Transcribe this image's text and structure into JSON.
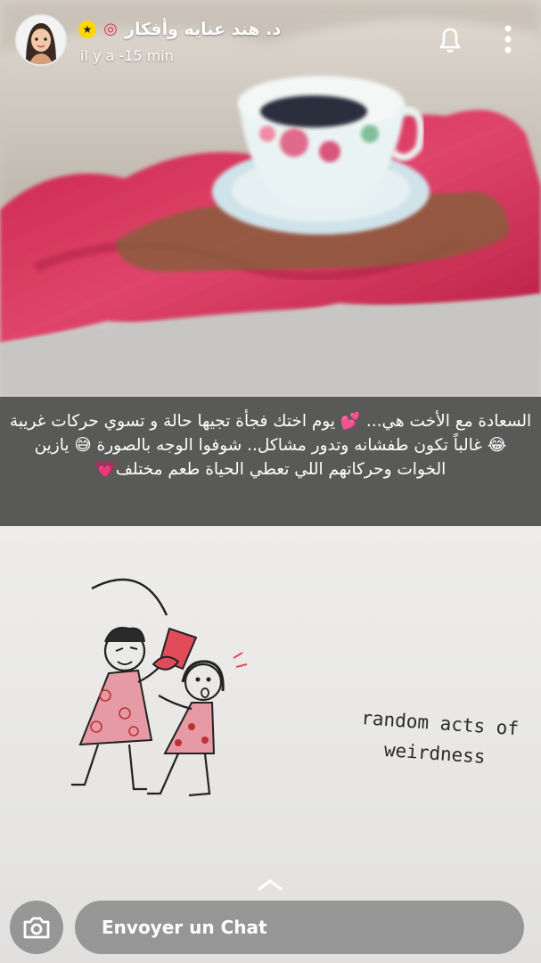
{
  "header": {
    "username": "د. هند عنايه وأفكار",
    "timestamp": "il y a -15 min",
    "icons": [
      "avatar",
      "star-badge-icon",
      "target-badge-icon",
      "bell-icon",
      "more-vertical-icon"
    ]
  },
  "story": {
    "caption": "السعادة مع الأخت هي... 💕 يوم اختك فجأة تجيها حالة و تسوي حركات غريبة😂 غالباً تكون طفشانه وتدور مشاكل.. شوفوا الوجه بالصورة 😅 يازين الخوات وحركاتهم اللي تعطي الحياة طعم مختلف💗",
    "sketch_text_line1": "random acts of",
    "sketch_text_line2": "weirdness"
  },
  "footer": {
    "chat_placeholder": "Envoyer un Chat",
    "icons": [
      "chevron-up-icon",
      "camera-icon"
    ]
  },
  "colors": {
    "badge_yellow": "#ffd50b",
    "target_red": "#e0334d",
    "blanket_pink": "#d9365c"
  }
}
